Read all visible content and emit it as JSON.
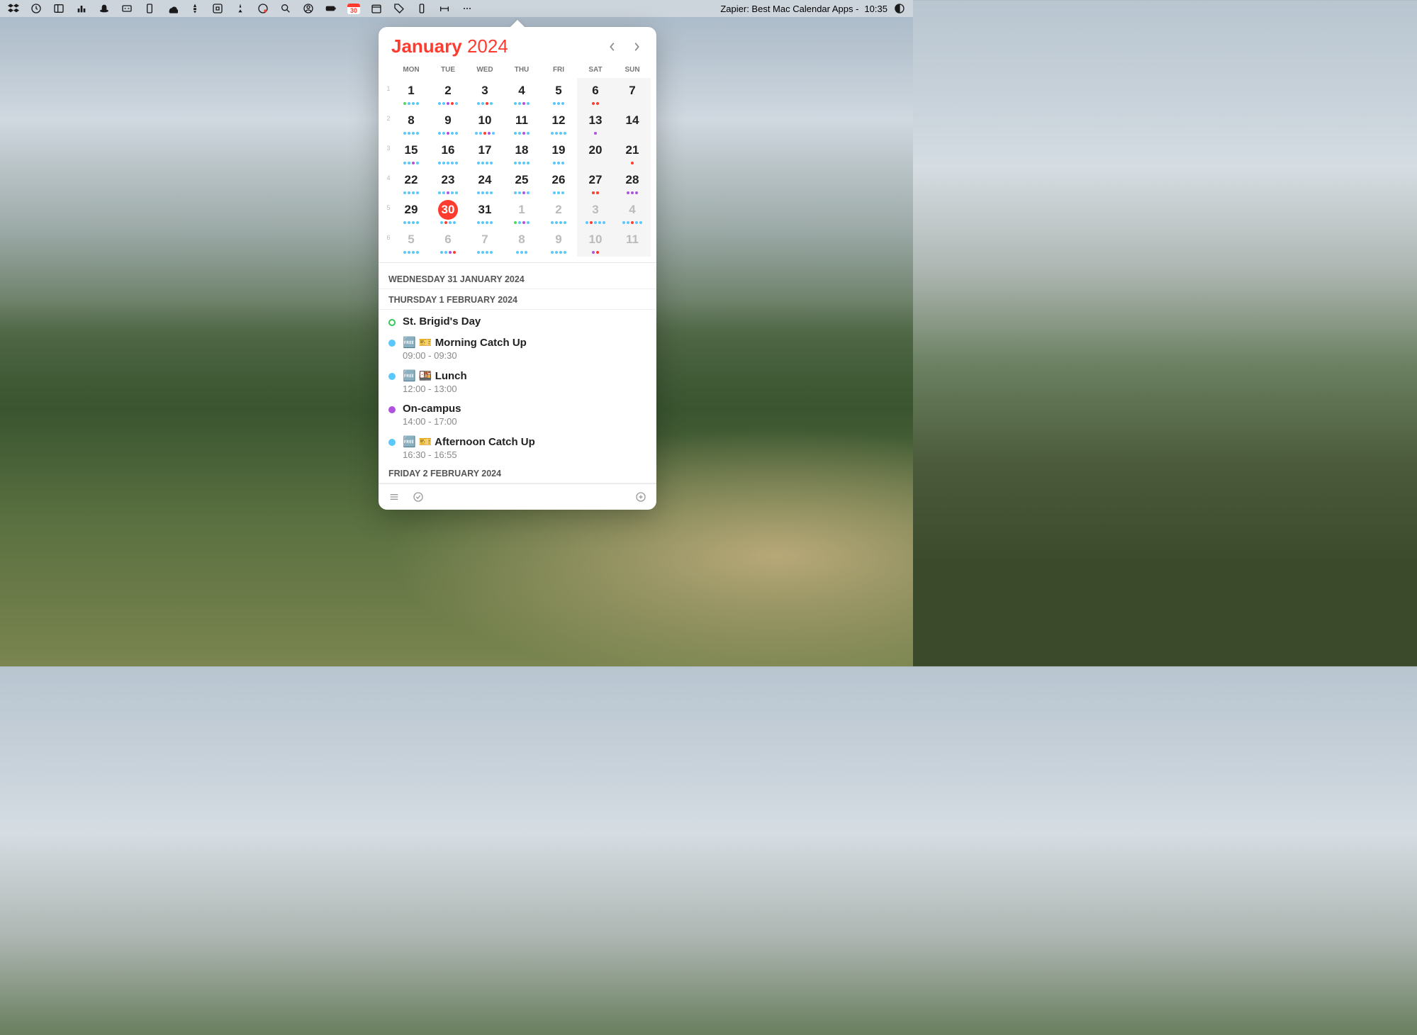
{
  "menubar": {
    "status_text": "Zapier: Best Mac Calendar Apps -",
    "time": "10:35",
    "calendar_icon_day": "30"
  },
  "calendar": {
    "month": "January",
    "year": "2024",
    "dow": [
      "MON",
      "TUE",
      "WED",
      "THU",
      "FRI",
      "SAT",
      "SUN"
    ],
    "weeks": [
      {
        "num": "1",
        "days": [
          {
            "n": "1",
            "dots": [
              "#4cd964",
              "#5ac8fa",
              "#5ac8fa",
              "#5ac8fa"
            ]
          },
          {
            "n": "2",
            "dots": [
              "#5ac8fa",
              "#5ac8fa",
              "#af52de",
              "#ff3b30",
              "#5ac8fa"
            ]
          },
          {
            "n": "3",
            "dots": [
              "#5ac8fa",
              "#5ac8fa",
              "#ff3b30",
              "#5ac8fa"
            ]
          },
          {
            "n": "4",
            "dots": [
              "#5ac8fa",
              "#5ac8fa",
              "#af52de",
              "#5ac8fa"
            ]
          },
          {
            "n": "5",
            "dots": [
              "#5ac8fa",
              "#5ac8fa",
              "#5ac8fa"
            ]
          },
          {
            "n": "6",
            "dots": [
              "#ff3b30",
              "#ff3b30"
            ],
            "weekend": true
          },
          {
            "n": "7",
            "dots": [],
            "weekend": true
          }
        ]
      },
      {
        "num": "2",
        "days": [
          {
            "n": "8",
            "dots": [
              "#5ac8fa",
              "#5ac8fa",
              "#5ac8fa",
              "#5ac8fa"
            ]
          },
          {
            "n": "9",
            "dots": [
              "#5ac8fa",
              "#5ac8fa",
              "#af52de",
              "#5ac8fa",
              "#5ac8fa"
            ]
          },
          {
            "n": "10",
            "dots": [
              "#5ac8fa",
              "#5ac8fa",
              "#ff3b30",
              "#af52de",
              "#5ac8fa"
            ]
          },
          {
            "n": "11",
            "dots": [
              "#5ac8fa",
              "#5ac8fa",
              "#af52de",
              "#5ac8fa"
            ]
          },
          {
            "n": "12",
            "dots": [
              "#5ac8fa",
              "#5ac8fa",
              "#5ac8fa",
              "#5ac8fa"
            ]
          },
          {
            "n": "13",
            "dots": [
              "#af52de"
            ],
            "weekend": true
          },
          {
            "n": "14",
            "dots": [],
            "weekend": true
          }
        ]
      },
      {
        "num": "3",
        "days": [
          {
            "n": "15",
            "dots": [
              "#5ac8fa",
              "#5ac8fa",
              "#af52de",
              "#5ac8fa"
            ]
          },
          {
            "n": "16",
            "dots": [
              "#5ac8fa",
              "#5ac8fa",
              "#5ac8fa",
              "#5ac8fa",
              "#5ac8fa"
            ]
          },
          {
            "n": "17",
            "dots": [
              "#5ac8fa",
              "#5ac8fa",
              "#5ac8fa",
              "#5ac8fa"
            ]
          },
          {
            "n": "18",
            "dots": [
              "#5ac8fa",
              "#5ac8fa",
              "#5ac8fa",
              "#5ac8fa"
            ]
          },
          {
            "n": "19",
            "dots": [
              "#5ac8fa",
              "#5ac8fa",
              "#5ac8fa"
            ]
          },
          {
            "n": "20",
            "dots": [],
            "weekend": true
          },
          {
            "n": "21",
            "dots": [
              "#ff3b30"
            ],
            "weekend": true
          }
        ]
      },
      {
        "num": "4",
        "days": [
          {
            "n": "22",
            "dots": [
              "#5ac8fa",
              "#5ac8fa",
              "#5ac8fa",
              "#5ac8fa"
            ]
          },
          {
            "n": "23",
            "dots": [
              "#5ac8fa",
              "#5ac8fa",
              "#af52de",
              "#5ac8fa",
              "#5ac8fa"
            ]
          },
          {
            "n": "24",
            "dots": [
              "#5ac8fa",
              "#5ac8fa",
              "#5ac8fa",
              "#5ac8fa"
            ]
          },
          {
            "n": "25",
            "dots": [
              "#5ac8fa",
              "#5ac8fa",
              "#af52de",
              "#5ac8fa"
            ]
          },
          {
            "n": "26",
            "dots": [
              "#5ac8fa",
              "#5ac8fa",
              "#5ac8fa"
            ]
          },
          {
            "n": "27",
            "dots": [
              "#ff3b30",
              "#ff3b30"
            ],
            "weekend": true
          },
          {
            "n": "28",
            "dots": [
              "#af52de",
              "#af52de",
              "#af52de"
            ],
            "weekend": true
          }
        ]
      },
      {
        "num": "5",
        "days": [
          {
            "n": "29",
            "dots": [
              "#5ac8fa",
              "#5ac8fa",
              "#5ac8fa",
              "#5ac8fa"
            ]
          },
          {
            "n": "30",
            "dots": [
              "#5ac8fa",
              "#ff3b30",
              "#5ac8fa",
              "#5ac8fa"
            ],
            "today": true
          },
          {
            "n": "31",
            "dots": [
              "#5ac8fa",
              "#5ac8fa",
              "#5ac8fa",
              "#5ac8fa"
            ]
          },
          {
            "n": "1",
            "dots": [
              "#4cd964",
              "#5ac8fa",
              "#af52de",
              "#5ac8fa"
            ],
            "muted": true
          },
          {
            "n": "2",
            "dots": [
              "#5ac8fa",
              "#5ac8fa",
              "#5ac8fa",
              "#5ac8fa"
            ],
            "muted": true
          },
          {
            "n": "3",
            "dots": [
              "#5ac8fa",
              "#ff3b30",
              "#5ac8fa",
              "#5ac8fa",
              "#5ac8fa"
            ],
            "muted": true,
            "weekend": true
          },
          {
            "n": "4",
            "dots": [
              "#5ac8fa",
              "#5ac8fa",
              "#ff3b30",
              "#5ac8fa",
              "#5ac8fa"
            ],
            "muted": true,
            "weekend": true
          }
        ]
      },
      {
        "num": "6",
        "days": [
          {
            "n": "5",
            "dots": [
              "#5ac8fa",
              "#5ac8fa",
              "#5ac8fa",
              "#5ac8fa"
            ],
            "muted": true
          },
          {
            "n": "6",
            "dots": [
              "#5ac8fa",
              "#5ac8fa",
              "#af52de",
              "#ff3b30"
            ],
            "muted": true
          },
          {
            "n": "7",
            "dots": [
              "#5ac8fa",
              "#5ac8fa",
              "#5ac8fa",
              "#5ac8fa"
            ],
            "muted": true
          },
          {
            "n": "8",
            "dots": [
              "#5ac8fa",
              "#5ac8fa",
              "#5ac8fa"
            ],
            "muted": true
          },
          {
            "n": "9",
            "dots": [
              "#5ac8fa",
              "#5ac8fa",
              "#5ac8fa",
              "#5ac8fa"
            ],
            "muted": true
          },
          {
            "n": "10",
            "dots": [
              "#af52de",
              "#ff3b30"
            ],
            "muted": true,
            "weekend": true
          },
          {
            "n": "11",
            "dots": [],
            "muted": true,
            "weekend": true
          }
        ]
      }
    ]
  },
  "agenda": {
    "sections": [
      {
        "header": "WEDNESDAY 31 JANUARY 2024",
        "events": []
      },
      {
        "header": "THURSDAY 1 FEBRUARY 2024",
        "events": [
          {
            "color": "#34c759",
            "ring": true,
            "title": "St. Brigid's Day",
            "time": ""
          },
          {
            "color": "#5ac8fa",
            "title": "🆓 🎫 Morning Catch Up",
            "time": "09:00 - 09:30"
          },
          {
            "color": "#5ac8fa",
            "title": "🆓 🍱 Lunch",
            "time": "12:00 - 13:00"
          },
          {
            "color": "#af52de",
            "title": "On-campus",
            "time": "14:00 - 17:00"
          },
          {
            "color": "#5ac8fa",
            "title": "🆓 🎫 Afternoon Catch Up",
            "time": "16:30 - 16:55"
          }
        ]
      },
      {
        "header": "FRIDAY 2 FEBRUARY 2024",
        "events": []
      }
    ]
  }
}
